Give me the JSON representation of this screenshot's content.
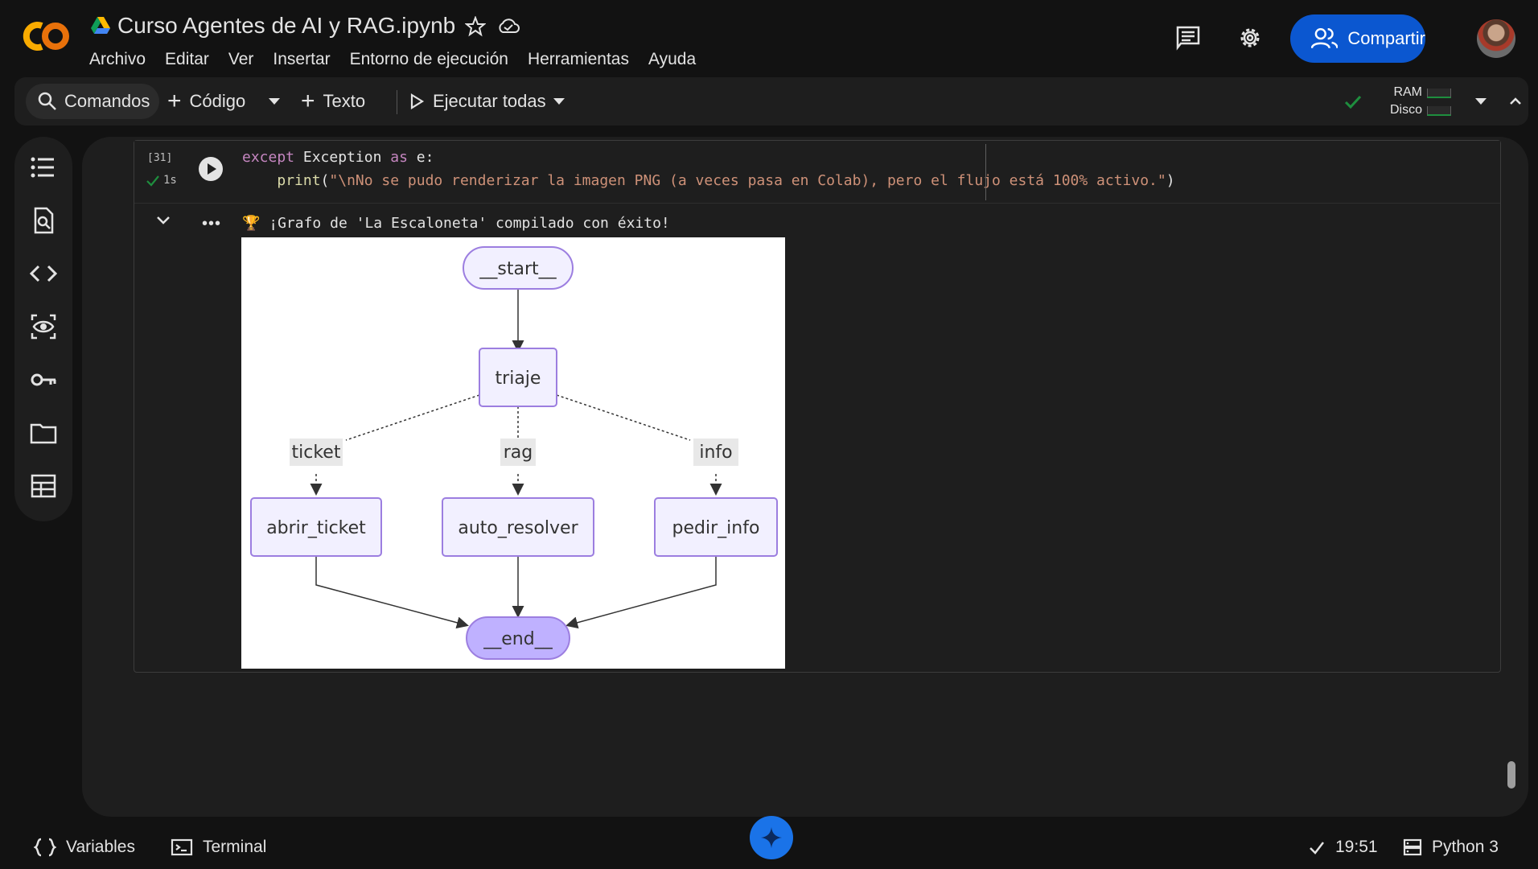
{
  "header": {
    "doc_title": "Curso Agentes de AI y RAG.ipynb",
    "logo_text": "CO",
    "menu": [
      "Archivo",
      "Editar",
      "Ver",
      "Insertar",
      "Entorno de ejecución",
      "Herramientas",
      "Ayuda"
    ],
    "share_label": "Compartir"
  },
  "toolbar": {
    "commands_label": "Comandos",
    "code_label": "Código",
    "text_label": "Texto",
    "run_all_label": "Ejecutar todas",
    "ram_label": "RAM",
    "disk_label": "Disco"
  },
  "sidebar": {
    "items": [
      {
        "icon": "table-of-contents-icon"
      },
      {
        "icon": "find-replace-icon"
      },
      {
        "icon": "code-snippets-icon"
      },
      {
        "icon": "variables-inspector-icon"
      },
      {
        "icon": "secrets-key-icon"
      },
      {
        "icon": "files-folder-icon"
      },
      {
        "icon": "data-table-icon"
      }
    ]
  },
  "cell": {
    "execution_count": "[31]",
    "execution_time": "1s",
    "code": {
      "line1": {
        "kw1": "except",
        "ident": " Exception ",
        "kw2": "as",
        "rest": " e:"
      },
      "line2": {
        "indent": "    ",
        "fn": "print",
        "open": "(",
        "str": "\"\\nNo se pudo renderizar la imagen PNG (a veces pasa en Colab), pero el flujo está 100% activo.\"",
        "close": ")"
      }
    },
    "output_more": "•••",
    "output_text": "🏆 ¡Grafo de 'La Escaloneta' compilado con éxito!"
  },
  "graph": {
    "nodes": {
      "start": "__start__",
      "triaje": "triaje",
      "abrir_ticket": "abrir_ticket",
      "auto_resolver": "auto_resolver",
      "pedir_info": "pedir_info",
      "end": "__end__"
    },
    "edge_labels": {
      "ticket": "ticket",
      "rag": "rag",
      "info": "info"
    },
    "colors": {
      "node_fill": "#f2f0ff",
      "node_stroke": "#9c7ee0",
      "terminal_fill": "#bfb1ff",
      "edge": "#333333"
    }
  },
  "statusbar": {
    "variables_label": "Variables",
    "terminal_label": "Terminal",
    "time": "19:51",
    "runtime_label": "Python 3"
  },
  "colors": {
    "accent": "#0b57d0",
    "logo_orange": "#f9ab00",
    "status_green": "#1e8e3e",
    "background": "#121212",
    "panel": "#1e1e1e"
  }
}
